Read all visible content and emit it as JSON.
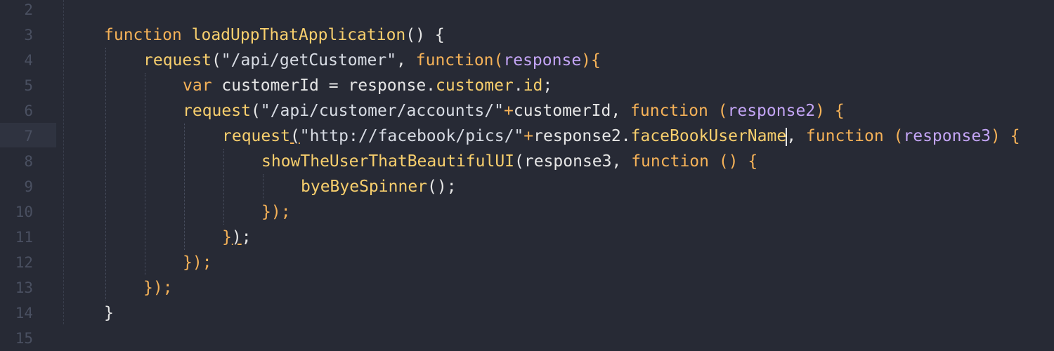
{
  "editor": {
    "line_numbers": [
      "2",
      "3",
      "4",
      "5",
      "6",
      "7",
      "8",
      "9",
      "10",
      "11",
      "12",
      "13",
      "14",
      "15"
    ],
    "colors": {
      "background": "#272a35",
      "keyword": "#f6b258",
      "function_name": "#f8cf6d",
      "param": "#c4a5f6",
      "text": "#e6e6e6"
    },
    "code": {
      "l3": {
        "kw": "function",
        "name": " loadUppThatApplication",
        "rest": "() {"
      },
      "l4": {
        "fn": "request",
        "p1": "(",
        "str": "\"/api/getCustomer\"",
        "p2": ", ",
        "kw": "function",
        "p3": "(",
        "param": "response",
        "p4": "){"
      },
      "l5": {
        "kw": "var",
        "rest": " customerId = response.",
        "prop": "customer",
        "dot": ".",
        "prop2": "id",
        "end": ";"
      },
      "l6": {
        "fn": "request",
        "p1": "(",
        "str": "\"/api/customer/accounts/\"",
        "op": "+",
        "id": "customerId",
        "p2": ", ",
        "kw": "function",
        "p3": " (",
        "param": "response2",
        "p4": ") {"
      },
      "l7": {
        "fn": "request",
        "p1": "(",
        "str": "\"http://facebook/pics/\"",
        "op": "+",
        "id": "response2.",
        "prop": "faceBookUserName",
        "p2": ", ",
        "kw": "function",
        "p3": " (",
        "param": "response3",
        "p4": ") {"
      },
      "l8": {
        "fn": "showTheUserThatBeautifulUI",
        "p1": "(response3, ",
        "kw": "function",
        "p2": " () {"
      },
      "l9": {
        "fn": "byeByeSpinner",
        "rest": "();"
      },
      "l10": {
        "rest": "});"
      },
      "l11": {
        "a": "}",
        "b": ")",
        "c": ";"
      },
      "l12": {
        "rest": "});"
      },
      "l13": {
        "rest": "});"
      },
      "l14": {
        "rest": "}"
      }
    }
  }
}
